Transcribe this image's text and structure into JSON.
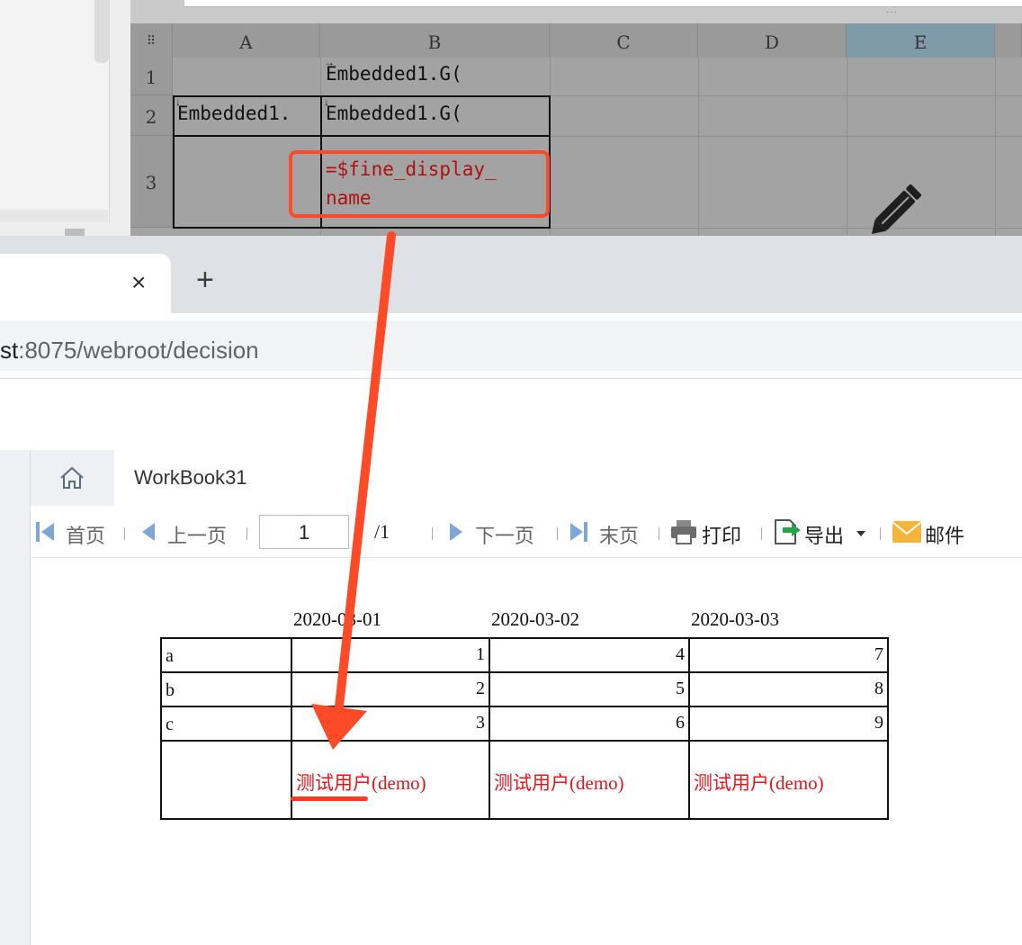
{
  "designer": {
    "columns": [
      "A",
      "B",
      "C",
      "D",
      "E"
    ],
    "rows": [
      "1",
      "2",
      "3"
    ],
    "cells": {
      "B1": "Embedded1.G(",
      "A2": "Embedded1.",
      "B2": "Embedded1.G(",
      "B3_line1": "=$fine_display_",
      "B3_line2": "name"
    },
    "selected_column": "E",
    "dots": "···"
  },
  "browser": {
    "close_symbol": "×",
    "new_tab_symbol": "+",
    "url_host": "st",
    "url_rest": ":8075/webroot/decision"
  },
  "viewer": {
    "tab_title": "WorkBook31",
    "toolbar": {
      "first_page": "首页",
      "prev_page": "上一页",
      "page_value": "1",
      "page_total": "/1",
      "next_page": "下一页",
      "last_page": "末页",
      "print": "打印",
      "export": "导出",
      "email": "邮件"
    },
    "report": {
      "dates": [
        "2020-03-01",
        "2020-03-02",
        "2020-03-03"
      ],
      "rows": [
        {
          "label": "a",
          "values": [
            "1",
            "4",
            "7"
          ]
        },
        {
          "label": "b",
          "values": [
            "2",
            "5",
            "8"
          ]
        },
        {
          "label": "c",
          "values": [
            "3",
            "6",
            "9"
          ]
        }
      ],
      "user_row": [
        "测试用户(demo)",
        "测试用户(demo)",
        "测试用户(demo)"
      ]
    }
  },
  "colors": {
    "annotation": "#ff4a27",
    "user_text": "#e4161c",
    "formula_text": "#b01010"
  }
}
